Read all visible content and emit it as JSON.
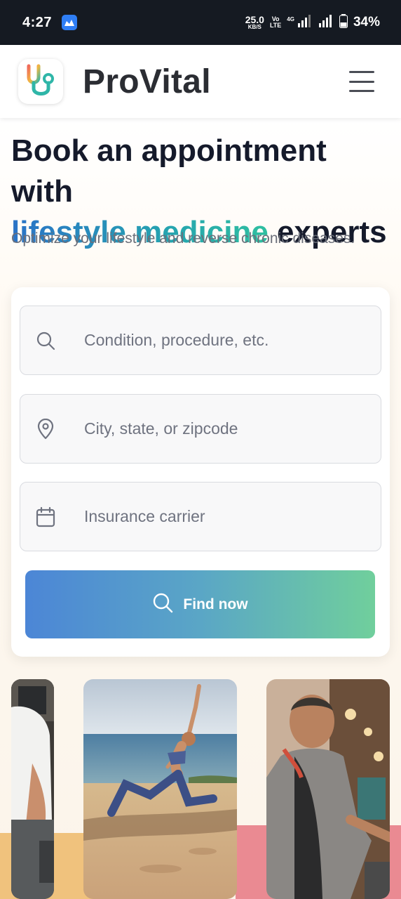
{
  "status_bar": {
    "time": "4:27",
    "net_speed": "25.0",
    "net_speed_unit": "KB/S",
    "volte_top": "Vo",
    "volte_bottom": "LTE",
    "network_type": "4G",
    "battery": "34%"
  },
  "header": {
    "brand": "ProVital",
    "logo_icon": "stethoscope-icon",
    "menu_icon": "hamburger-menu-icon"
  },
  "hero": {
    "title_line1": "Book an appointment with",
    "title_highlight": "lifestyle medicine",
    "title_end": " experts",
    "subtitle": "Optimize your lifestyle and reverse chronic diseases."
  },
  "search": {
    "condition_placeholder": "Condition, procedure, etc.",
    "location_placeholder": "City, state, or zipcode",
    "insurance_placeholder": "Insurance carrier",
    "find_label": "Find now"
  },
  "colors": {
    "status_bar": "#151a22",
    "brand_text": "#2b2d33",
    "title_text": "#151a2b",
    "gradient_start": "#4c86d6",
    "gradient_end": "#70cf9c",
    "band_yellow": "#f0c27d",
    "band_pink": "#ea8a92"
  }
}
